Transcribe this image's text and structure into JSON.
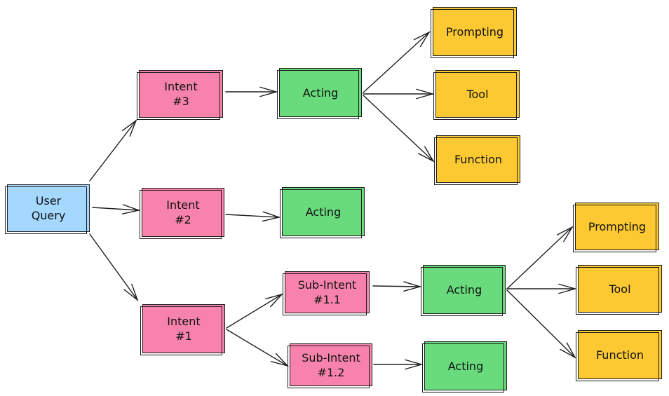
{
  "diagram": {
    "colors": {
      "query": "#a5d8ff",
      "intent": "#f783ac",
      "acting": "#69db7c",
      "output": "#fcc932",
      "stroke": "#1e1e1e"
    },
    "nodes": {
      "user_query": "User\nQuery",
      "intent_3": "Intent\n#3",
      "intent_2": "Intent\n#2",
      "intent_1": "Intent\n#1",
      "acting_3": "Acting",
      "acting_2": "Acting",
      "sub_intent_1_1": "Sub-Intent\n#1.1",
      "sub_intent_1_2": "Sub-Intent\n#1.2",
      "acting_1_1": "Acting",
      "acting_1_2": "Acting",
      "prompting_top": "Prompting",
      "tool_top": "Tool",
      "function_top": "Function",
      "prompting_bottom": "Prompting",
      "tool_bottom": "Tool",
      "function_bottom": "Function"
    },
    "edges": [
      [
        "user_query",
        "intent_3"
      ],
      [
        "user_query",
        "intent_2"
      ],
      [
        "user_query",
        "intent_1"
      ],
      [
        "intent_3",
        "acting_3"
      ],
      [
        "intent_2",
        "acting_2"
      ],
      [
        "intent_1",
        "sub_intent_1_1"
      ],
      [
        "intent_1",
        "sub_intent_1_2"
      ],
      [
        "sub_intent_1_1",
        "acting_1_1"
      ],
      [
        "sub_intent_1_2",
        "acting_1_2"
      ],
      [
        "acting_3",
        "prompting_top"
      ],
      [
        "acting_3",
        "tool_top"
      ],
      [
        "acting_3",
        "function_top"
      ],
      [
        "acting_1_1",
        "prompting_bottom"
      ],
      [
        "acting_1_1",
        "tool_bottom"
      ],
      [
        "acting_1_1",
        "function_bottom"
      ]
    ]
  }
}
